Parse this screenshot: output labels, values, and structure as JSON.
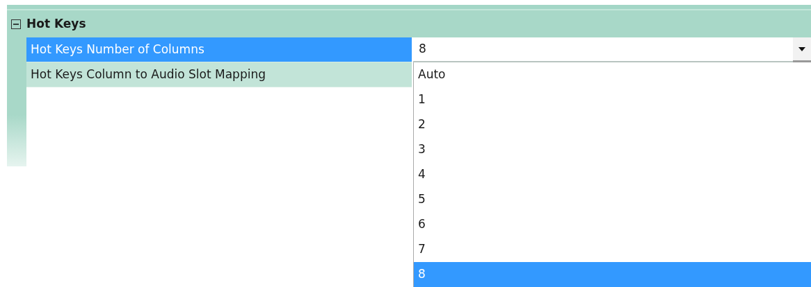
{
  "category": {
    "title": "Hot Keys",
    "expanded": true
  },
  "properties": [
    {
      "name": "Hot Keys Number of Columns",
      "selected": true,
      "value": "8",
      "dropdown_open": true
    },
    {
      "name": "Hot Keys Column to Audio Slot Mapping",
      "selected": false
    }
  ],
  "dropdown": {
    "options": [
      {
        "label": "Auto",
        "selected": false
      },
      {
        "label": "1",
        "selected": false
      },
      {
        "label": "2",
        "selected": false
      },
      {
        "label": "3",
        "selected": false
      },
      {
        "label": "4",
        "selected": false
      },
      {
        "label": "5",
        "selected": false
      },
      {
        "label": "6",
        "selected": false
      },
      {
        "label": "7",
        "selected": false
      },
      {
        "label": "8",
        "selected": true
      }
    ]
  }
}
